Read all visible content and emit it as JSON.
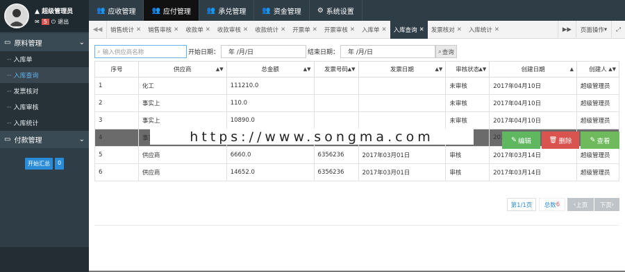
{
  "user": {
    "name": "超级管理员",
    "mail_count": "5",
    "logout": "退出"
  },
  "sidebar": {
    "groups": [
      {
        "label": "原料管理"
      },
      {
        "label": "付款管理"
      }
    ],
    "items": [
      {
        "label": "入库单"
      },
      {
        "label": "入库查询"
      },
      {
        "label": "发票核对"
      },
      {
        "label": "入库审核"
      },
      {
        "label": "入库统计"
      }
    ],
    "summary_button": "开始汇总",
    "summary_count": "0"
  },
  "topnav": {
    "tabs": [
      {
        "label": "应收管理"
      },
      {
        "label": "应付管理"
      },
      {
        "label": "承兑管理"
      },
      {
        "label": "资金管理"
      },
      {
        "label": "系统设置"
      }
    ]
  },
  "pagetabs": {
    "tabs": [
      {
        "label": "销售统计"
      },
      {
        "label": "销售审核"
      },
      {
        "label": "收款单"
      },
      {
        "label": "收款审核"
      },
      {
        "label": "收款统计"
      },
      {
        "label": "开票单"
      },
      {
        "label": "开票审核"
      },
      {
        "label": "入库单"
      },
      {
        "label": "入库查询"
      },
      {
        "label": "发票核对"
      },
      {
        "label": "入库统计"
      }
    ],
    "page_ops": "页面操作"
  },
  "filter": {
    "search_placeholder": "输入供应商名称",
    "start_label": "开始日期：",
    "end_label": "结束日期：",
    "date_placeholder": "年 /月/日",
    "query": "查询"
  },
  "table": {
    "headers": [
      "序号",
      "供应商",
      "总金额",
      "发票号码",
      "发票日期",
      "审核状态",
      "创建日期",
      "创建人"
    ],
    "rows": [
      [
        "1",
        "化工",
        "111210.0",
        "",
        "",
        "未审核",
        "2017年04月10日",
        "超级管理员"
      ],
      [
        "2",
        "事实上",
        "110.0",
        "",
        "",
        "未审核",
        "2017年04月10日",
        "超级管理员"
      ],
      [
        "3",
        "事实上",
        "10890.0",
        "",
        "",
        "未审核",
        "2017年04月10日",
        "超级管理员"
      ],
      [
        "4",
        "事实",
        "",
        "",
        "",
        "",
        "2017",
        ""
      ],
      [
        "5",
        "供应商",
        "6660.0",
        "6356236",
        "2017年03月01日",
        "审核",
        "2017年03月14日",
        "超级管理员"
      ],
      [
        "6",
        "供应商",
        "14652.0",
        "6356236",
        "2017年03月01日",
        "审核",
        "2017年03月14日",
        "超级管理员"
      ]
    ]
  },
  "actions": {
    "edit": "编辑",
    "delete": "删除",
    "view": "查看"
  },
  "watermark": "https://www.songma.com",
  "pager": {
    "page": "第1/1页",
    "total_label": "总数",
    "total": "6",
    "prev": "上页",
    "next": "下页"
  },
  "colors": {
    "edit": "#5fb760",
    "delete": "#d9534f",
    "view": "#6fba5c",
    "link": "#2a8cd6"
  }
}
